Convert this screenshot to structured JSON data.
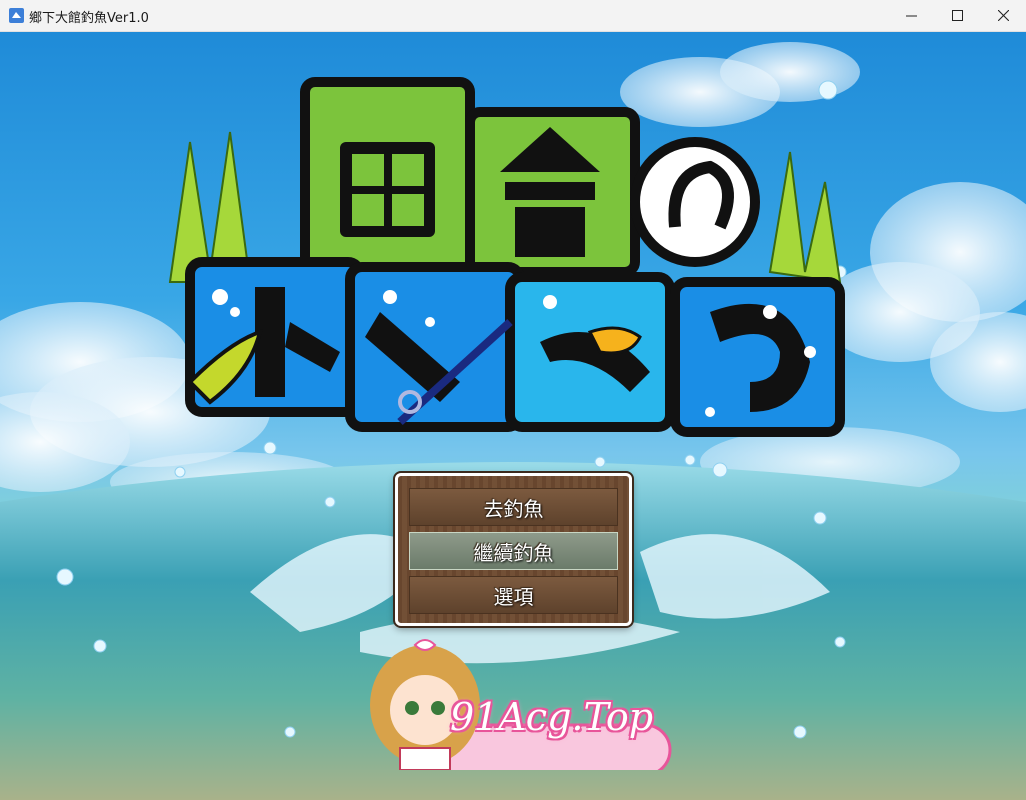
{
  "window": {
    "title": "鄉下大館釣魚Ver1.0",
    "controls": [
      "minimize-icon",
      "maximize-icon",
      "close-icon"
    ]
  },
  "logo": {
    "text_lines": [
      "田舎の",
      "ドン釣り"
    ]
  },
  "menu": {
    "items": [
      {
        "label": "去釣魚",
        "selected": false
      },
      {
        "label": "繼續釣魚",
        "selected": true
      },
      {
        "label": "選項",
        "selected": false
      }
    ]
  },
  "watermark": {
    "text": "91Acg.Top"
  },
  "colors": {
    "sky": "#2a8fde",
    "logo_green": "#7ec43a",
    "logo_blue": "#1a8ee6",
    "menu_wood": "#6e4a30",
    "menu_highlight": "#8e9a8a",
    "watermark_pink": "#e8559a"
  }
}
